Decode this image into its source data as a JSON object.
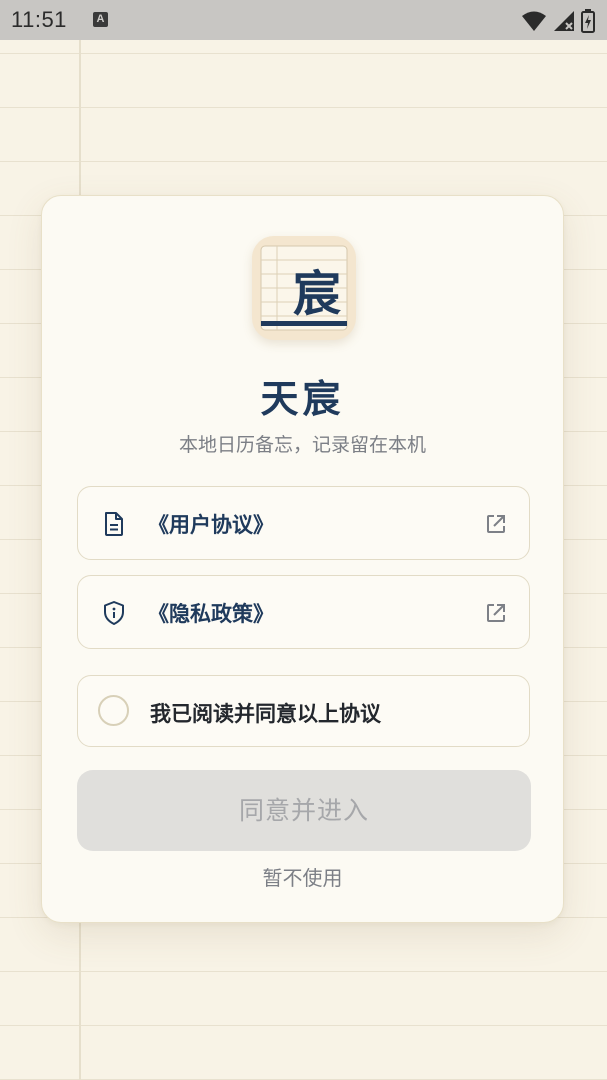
{
  "status_bar": {
    "time": "11:51",
    "notification_glyph": "A",
    "icons": [
      "wifi-icon",
      "signal-icon",
      "battery-icon"
    ]
  },
  "app": {
    "icon_glyph": "宸",
    "title": "天宸",
    "subtitle": "本地日历备忘，记录留在本机"
  },
  "links": {
    "user_agreement": "《用户协议》",
    "privacy_policy": "《隐私政策》"
  },
  "consent": {
    "label": "我已阅读并同意以上协议",
    "checked": false
  },
  "actions": {
    "enter_label": "同意并进入",
    "enter_enabled": false,
    "skip_label": "暂不使用"
  },
  "colors": {
    "accent_navy": "#1f3a5c",
    "background": "#f8f3e6",
    "card": "#fcfaf3",
    "disabled_button": "#e0dfdc"
  }
}
